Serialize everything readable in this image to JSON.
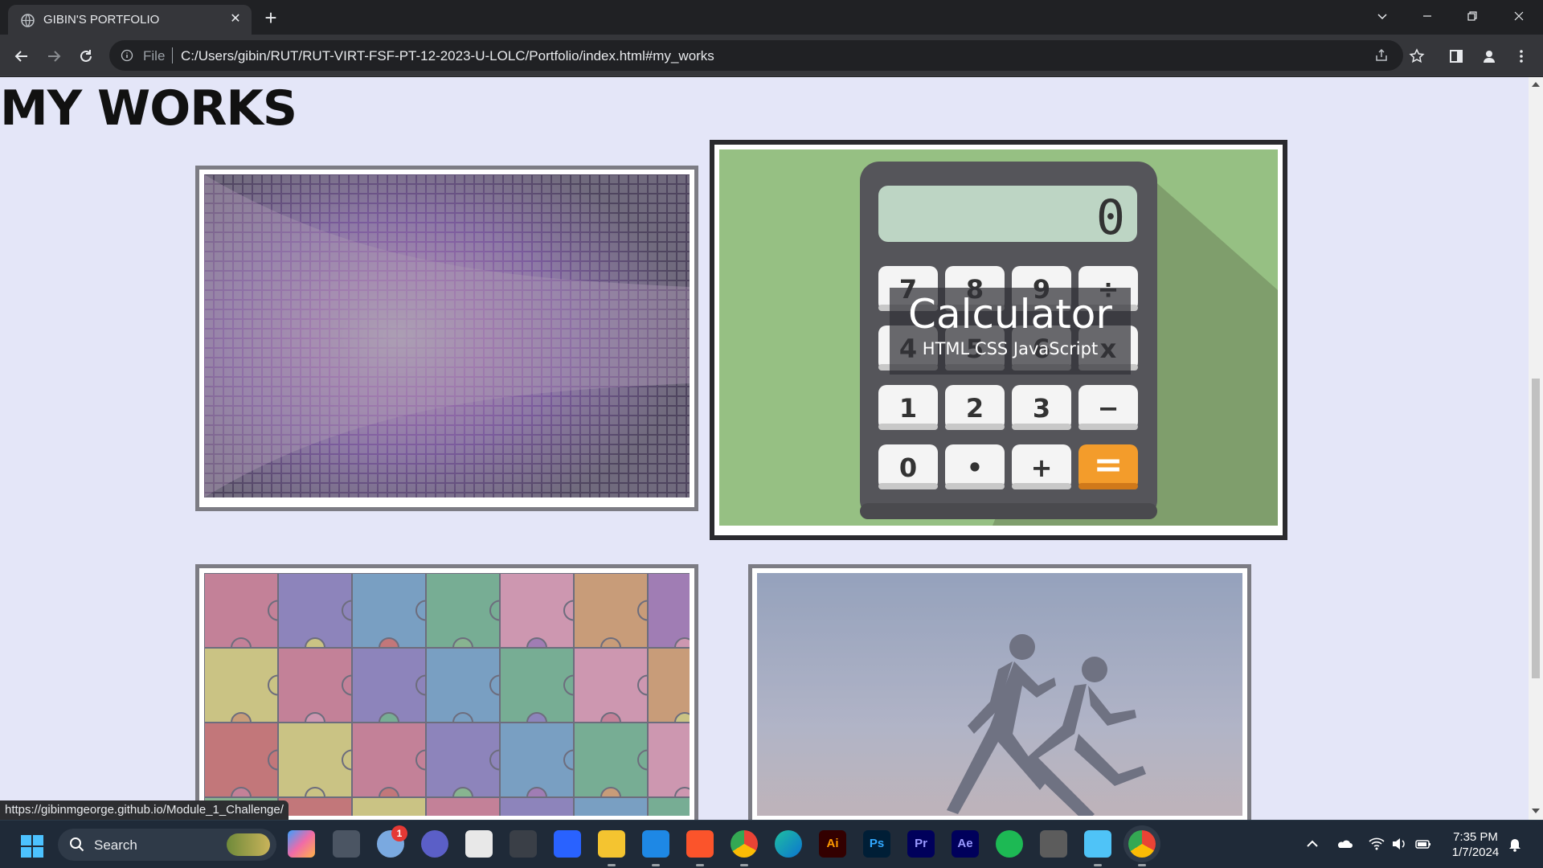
{
  "browser": {
    "tab_title": "GIBIN'S PORTFOLIO",
    "file_label": "File",
    "url": "C:/Users/gibin/RUT/RUT-VIRT-FSF-PT-12-2023-U-LOLC/Portfolio/index.html#my_works",
    "status_url": "https://gibinmgeorge.github.io/Module_1_Challenge/"
  },
  "page": {
    "section_title": "MY WORKS",
    "works": [
      {
        "name": "work-music-visualizer",
        "image": "purple-mosaic-image"
      },
      {
        "name": "work-calculator",
        "image": "calculator-image",
        "caption_title": "Calculator",
        "caption_tech": "HTML CSS JavaScript"
      },
      {
        "name": "work-puzzle",
        "image": "puzzle-image"
      },
      {
        "name": "work-runners",
        "image": "runners-image"
      }
    ],
    "calculator_display": "0",
    "calculator_keys": [
      "7",
      "8",
      "9",
      "÷",
      "4",
      "5",
      "6",
      "x",
      "1",
      "2",
      "3",
      "−",
      "0",
      "•",
      "+",
      "="
    ]
  },
  "taskbar": {
    "search_label": "Search",
    "time": "7:35 PM",
    "date": "1/7/2024",
    "notification_badge": "1",
    "apps": [
      "copilot-icon",
      "task-view-icon",
      "weather-icon",
      "teams-icon",
      "store-icon",
      "unity-icon",
      "mathworks-icon",
      "file-explorer-icon",
      "vscode-icon",
      "brave-icon",
      "chrome-icon",
      "edge-icon",
      "illustrator-icon",
      "photoshop-icon",
      "premiere-icon",
      "after-effects-icon",
      "spotify-icon",
      "git-icon",
      "notepad-icon",
      "chrome-active-icon"
    ],
    "app_labels": {
      "illustrator": "Ai",
      "photoshop": "Ps",
      "premiere": "Pr",
      "after_effects": "Ae"
    }
  },
  "colors": {
    "page_bg": "#e4e6f8",
    "calc_green": "#96c083",
    "calc_orange": "#f39c2b"
  }
}
